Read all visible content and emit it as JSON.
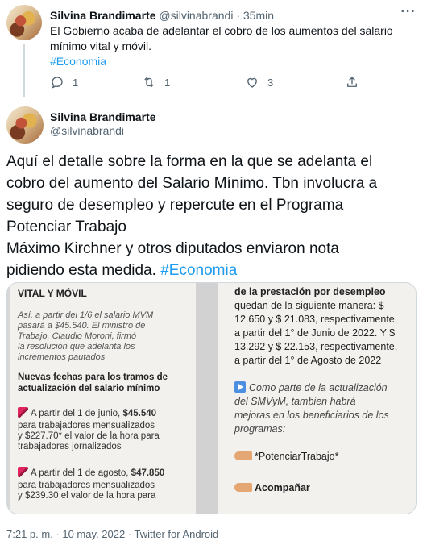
{
  "reply_tweet": {
    "author_name": "Silvina Brandimarte",
    "handle": "@silvinabrandi",
    "separator": "·",
    "time": "35min",
    "text": "El Gobierno acaba de adelantar el cobro de los aumentos del salario mínimo vital y móvil.",
    "hashtag": "#Economia",
    "actions": {
      "reply_count": "1",
      "retweet_count": "1",
      "like_count": "3"
    }
  },
  "main_tweet": {
    "author_name": "Silvina Brandimarte",
    "handle": "@silvinabrandi",
    "text_lines": [
      "Aquí el detalle sobre la forma en la que se adelanta el",
      "cobro del aumento del Salario Mínimo. Tbn involucra a",
      "seguro de desempleo y repercute en el Programa",
      "Potenciar Trabajo",
      "Máximo Kirchner y otros diputados enviaron nota",
      "pidiendo esta medida."
    ],
    "hashtag": "#Economia",
    "timestamp": "7:21 p. m. · 10 may. 2022 · Twitter for Android"
  },
  "media": {
    "left_panel": {
      "heading": "VITAL Y MÓVIL",
      "intro_lines": [
        "Así, a partir del 1/6 el salario MVM",
        "pasará a $45.540. El ministro de",
        "Trabajo, Claudio Moroni, firmó",
        "la resolución que adelanta los",
        "incrementos pautados"
      ],
      "subheading_lines": [
        "Nuevas fechas para los tramos de",
        "actualización del salario mínimo"
      ],
      "item1_lead": "A partir del 1 de junio, ",
      "item1_amount": "$45.540",
      "item1_lines": [
        "para trabajadores mensualizados",
        "y $227.70* el valor de la hora para",
        "trabajadores jornalizados"
      ],
      "item2_lead": "A partir del 1 de agosto, ",
      "item2_amount": "$47.850",
      "item2_lines": [
        "para trabajadores mensualizados",
        "y $239.30 el valor de la hora para"
      ]
    },
    "right_panel": {
      "heading": "de la prestación por desempleo",
      "lines": [
        "quedan de la siguiente manera: $",
        "12.650 y $ 21.083, respectivamente,",
        "a partir del 1° de Junio de 2022. Y $",
        "13.292 y $ 22.153, respectivamente,",
        "a partir del 1° de Agosto de 2022"
      ],
      "italic_lines": [
        "Como parte de la actualización",
        "del SMVyM, tambien habrá",
        "mejoras en los beneficiarios de los",
        "programas:"
      ],
      "program1": "*PotenciarTrabajo*",
      "program2": "Acompañar"
    }
  },
  "colors": {
    "text": "#0f1419",
    "muted": "#536471",
    "link": "#1d9bf0",
    "border": "#cfd9de"
  }
}
